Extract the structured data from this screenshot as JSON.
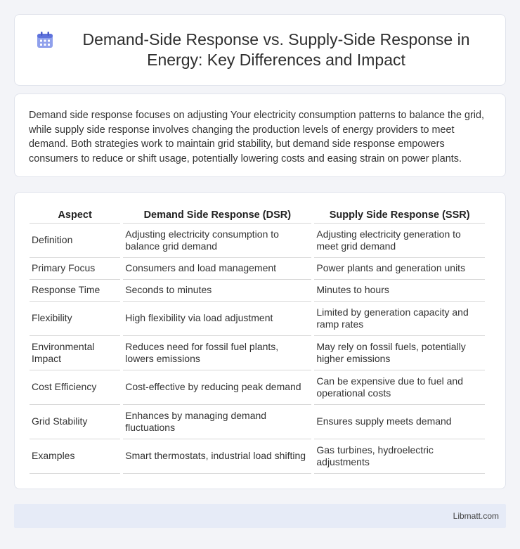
{
  "header": {
    "title": "Demand-Side Response vs. Supply-Side Response in Energy: Key Differences and Impact",
    "icon": "calendar-icon"
  },
  "intro": {
    "text": "Demand side response focuses on adjusting Your electricity consumption patterns to balance the grid, while supply side response involves changing the production levels of energy providers to meet demand. Both strategies work to maintain grid stability, but demand side response empowers consumers to reduce or shift usage, potentially lowering costs and easing strain on power plants."
  },
  "table": {
    "headers": [
      "Aspect",
      "Demand Side Response (DSR)",
      "Supply Side Response (SSR)"
    ],
    "rows": [
      [
        "Definition",
        "Adjusting electricity consumption to balance grid demand",
        "Adjusting electricity generation to meet grid demand"
      ],
      [
        "Primary Focus",
        "Consumers and load management",
        "Power plants and generation units"
      ],
      [
        "Response Time",
        "Seconds to minutes",
        "Minutes to hours"
      ],
      [
        "Flexibility",
        "High flexibility via load adjustment",
        "Limited by generation capacity and ramp rates"
      ],
      [
        "Environmental Impact",
        "Reduces need for fossil fuel plants, lowers emissions",
        "May rely on fossil fuels, potentially higher emissions"
      ],
      [
        "Cost Efficiency",
        "Cost-effective by reducing peak demand",
        "Can be expensive due to fuel and operational costs"
      ],
      [
        "Grid Stability",
        "Enhances by managing demand fluctuations",
        "Ensures supply meets demand"
      ],
      [
        "Examples",
        "Smart thermostats, industrial load shifting",
        "Gas turbines, hydroelectric adjustments"
      ]
    ]
  },
  "footer": {
    "brand": "Libmatt.com"
  },
  "colors": {
    "page_bg": "#f3f4f8",
    "footer_bg": "#e6ebf7",
    "icon_accent": "#6b7fe0"
  }
}
